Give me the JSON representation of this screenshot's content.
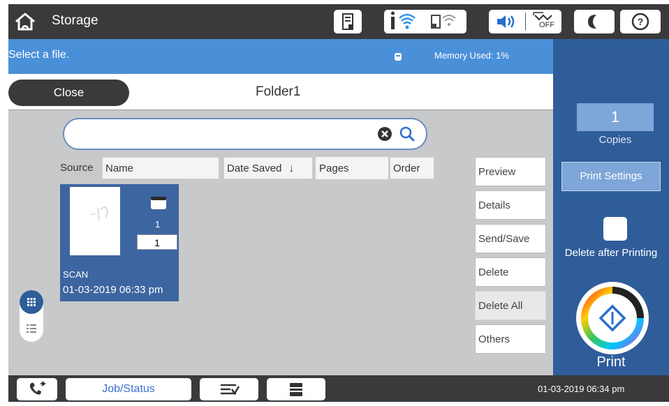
{
  "header": {
    "title": "Storage",
    "icons": [
      "home-icon",
      "ink-icon",
      "wifi-icon",
      "wifi-direct-icon",
      "sound-icon",
      "eco-off-icon",
      "sleep-icon",
      "help-icon"
    ],
    "eco_label": "OFF"
  },
  "status": {
    "message": "Select a file.",
    "memory": "Memory Used: 1%"
  },
  "folder": {
    "close_label": "Close",
    "name": "Folder1"
  },
  "search": {
    "value": "",
    "placeholder": ""
  },
  "columns": {
    "source": "Source",
    "name": "Name",
    "date_saved": "Date Saved",
    "sort_icon": "↓",
    "pages": "Pages",
    "order": "Order"
  },
  "file": {
    "count": "1",
    "pages": "1",
    "source": "SCAN",
    "date": "01-03-2019 06:33 pm"
  },
  "actions": {
    "preview": "Preview",
    "details": "Details",
    "send_save": "Send/Save",
    "delete": "Delete",
    "delete_all": "Delete All",
    "others": "Others"
  },
  "panel": {
    "copies_value": "1",
    "copies_label": "Copies",
    "print_settings": "Print Settings",
    "delete_after_printing": "Delete after Printing",
    "print_label": "Print"
  },
  "footer": {
    "job_status": "Job/Status",
    "datetime": "01-03-2019 06:34 pm"
  },
  "colors": {
    "topbar": "#3a3a3c",
    "statusbar": "#4a90d9",
    "panel": "#2f5d9a",
    "card": "#3d65a0",
    "accent": "#3a6fd0"
  }
}
